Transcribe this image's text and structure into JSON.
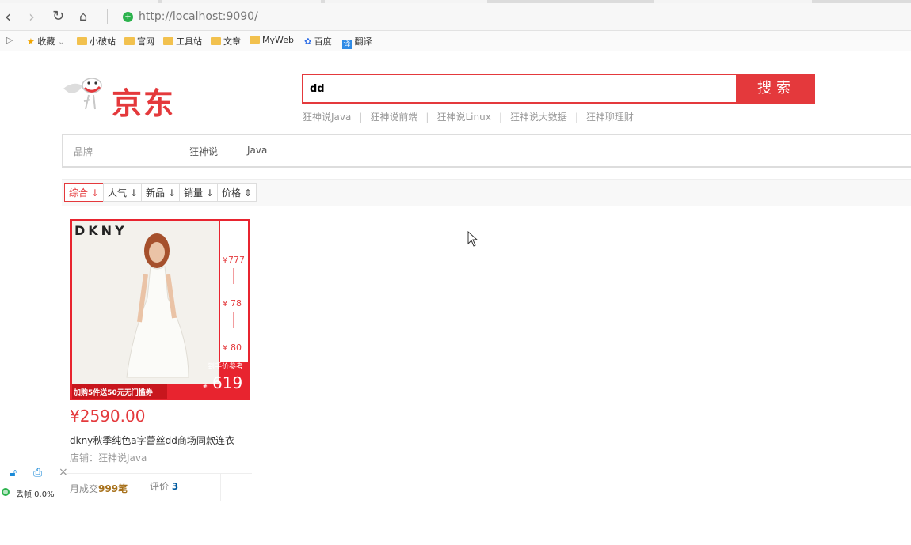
{
  "browser": {
    "url_host": "http://localhost",
    "url_port": ":9090/",
    "bookmarks": [
      {
        "label": "收藏"
      },
      {
        "label": "小破站"
      },
      {
        "label": "官网"
      },
      {
        "label": "工具站"
      },
      {
        "label": "文章"
      },
      {
        "label": "MyWeb"
      },
      {
        "label": "百度"
      },
      {
        "label": "翻译"
      }
    ]
  },
  "logo": {
    "text": "京东"
  },
  "search": {
    "value": "dd",
    "button": "搜索"
  },
  "hot_keywords": [
    "狂神说Java",
    "狂神说前端",
    "狂神说Linux",
    "狂神说大数据",
    "狂神聊理财"
  ],
  "brand": {
    "label": "品牌",
    "values": [
      "狂神说",
      "Java"
    ]
  },
  "sort": [
    "综合",
    "人气",
    "新品",
    "销量",
    "价格"
  ],
  "product": {
    "banner": {
      "brand": "DKNY",
      "price_main": "619",
      "p1": "777",
      "p2": "78",
      "p3": "80",
      "tag": "到手价参考",
      "promo": "加购5件送50元无门槛券"
    },
    "price": "¥2590.00",
    "title": "dkny秋季纯色a字蕾丝dd商场同款连衣",
    "shop_label": "店铺：",
    "shop": "狂神说Java",
    "sales_label": "月成交",
    "sales": "999笔",
    "review_label": "评价",
    "review": "3"
  },
  "float_widget": {
    "label": "丢帧 0.0%"
  }
}
